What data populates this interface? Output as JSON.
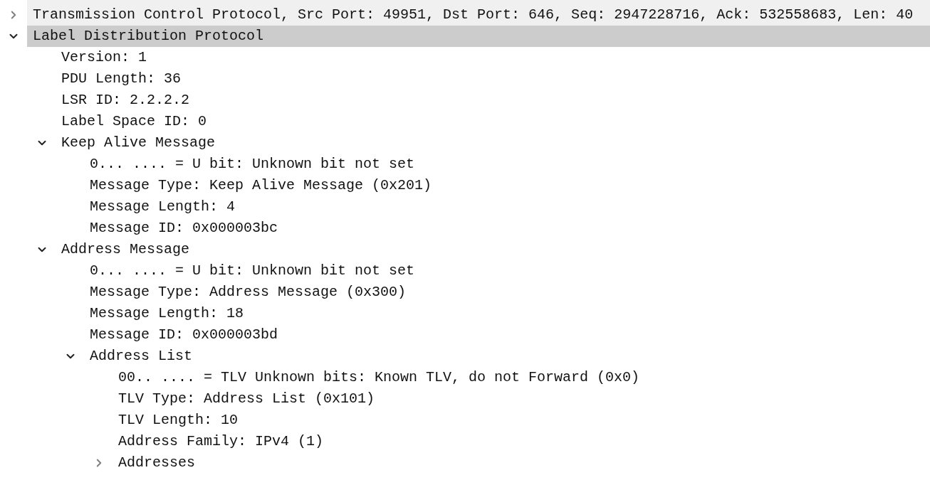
{
  "tree": [
    {
      "kind": "group",
      "label": "Transmission Control Protocol, Src Port: 49951, Dst Port: 646, Seq: 2947228716, Ack: 532558683, Len: 40",
      "expanded": false,
      "selected": false
    },
    {
      "kind": "group",
      "label": "Label Distribution Protocol",
      "expanded": true,
      "selected": true,
      "children": [
        {
          "kind": "field",
          "label": "Version: 1",
          "selected": false
        },
        {
          "kind": "field",
          "label": "PDU Length: 36",
          "selected": false
        },
        {
          "kind": "field",
          "label": "LSR ID: 2.2.2.2",
          "selected": false
        },
        {
          "kind": "field",
          "label": "Label Space ID: 0",
          "selected": false
        },
        {
          "kind": "group",
          "label": "Keep Alive Message",
          "expanded": true,
          "selected": false,
          "children": [
            {
              "kind": "field",
              "label": "0... .... = U bit: Unknown bit not set",
              "selected": false
            },
            {
              "kind": "field",
              "label": "Message Type: Keep Alive Message (0x201)",
              "selected": false
            },
            {
              "kind": "field",
              "label": "Message Length: 4",
              "selected": false
            },
            {
              "kind": "field",
              "label": "Message ID: 0x000003bc",
              "selected": false
            }
          ]
        },
        {
          "kind": "group",
          "label": "Address Message",
          "expanded": true,
          "selected": false,
          "children": [
            {
              "kind": "field",
              "label": "0... .... = U bit: Unknown bit not set",
              "selected": false
            },
            {
              "kind": "field",
              "label": "Message Type: Address Message (0x300)",
              "selected": false
            },
            {
              "kind": "field",
              "label": "Message Length: 18",
              "selected": false
            },
            {
              "kind": "field",
              "label": "Message ID: 0x000003bd",
              "selected": false
            },
            {
              "kind": "group",
              "label": "Address List",
              "expanded": true,
              "selected": false,
              "children": [
                {
                  "kind": "field",
                  "label": "00.. .... = TLV Unknown bits: Known TLV, do not Forward (0x0)",
                  "selected": false
                },
                {
                  "kind": "field",
                  "label": "TLV Type: Address List (0x101)",
                  "selected": false
                },
                {
                  "kind": "field",
                  "label": "TLV Length: 10",
                  "selected": false
                },
                {
                  "kind": "field",
                  "label": "Address Family: IPv4 (1)",
                  "selected": false
                },
                {
                  "kind": "group",
                  "label": "Addresses",
                  "expanded": false,
                  "selected": false
                }
              ]
            }
          ]
        }
      ]
    }
  ]
}
